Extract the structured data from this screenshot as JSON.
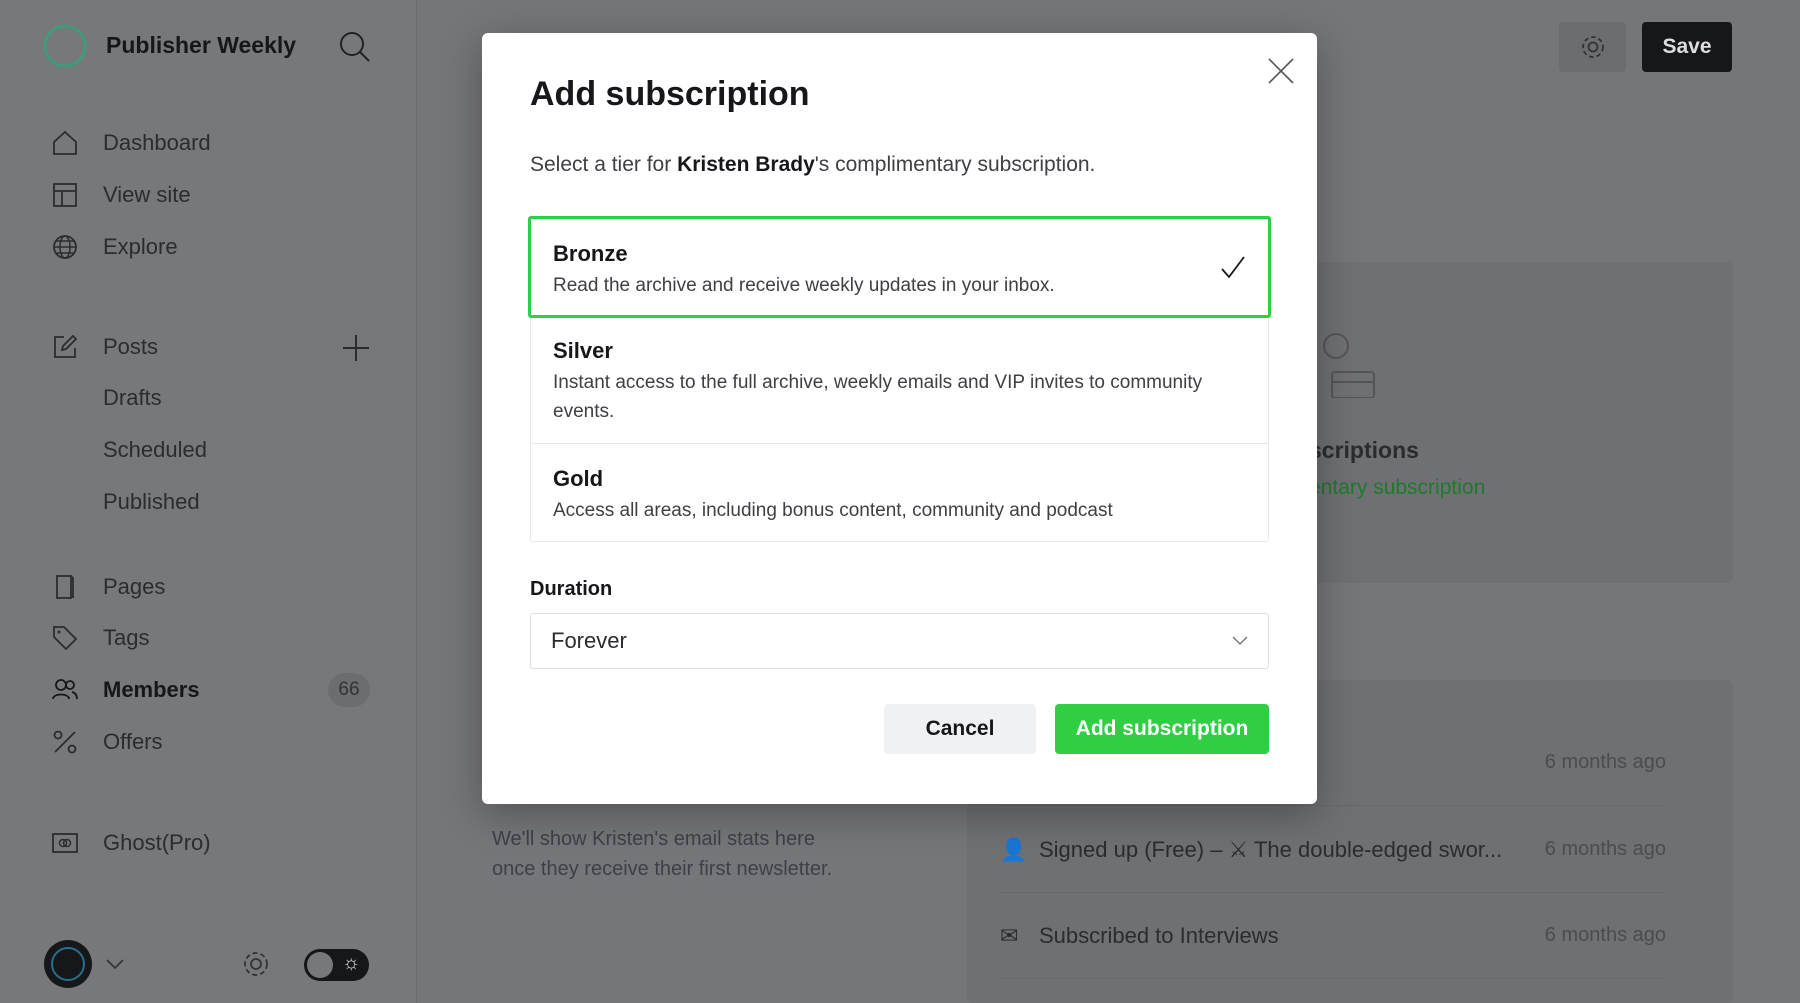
{
  "sidebar": {
    "site_title": "Publisher Weekly",
    "items": [
      {
        "label": "Dashboard",
        "icon": "home-icon"
      },
      {
        "label": "View site",
        "icon": "layout-icon"
      },
      {
        "label": "Explore",
        "icon": "globe-icon"
      },
      {
        "label": "Posts",
        "icon": "edit-icon"
      },
      {
        "label": "Drafts"
      },
      {
        "label": "Scheduled"
      },
      {
        "label": "Published"
      },
      {
        "label": "Pages",
        "icon": "page-icon"
      },
      {
        "label": "Tags",
        "icon": "tag-icon"
      },
      {
        "label": "Members",
        "icon": "members-icon",
        "count": "66"
      },
      {
        "label": "Offers",
        "icon": "percent-icon"
      },
      {
        "label": "Ghost(Pro)",
        "icon": "ghost-pro-icon"
      }
    ]
  },
  "header": {
    "save_label": "Save"
  },
  "background": {
    "subscriptions_title": "scriptions",
    "complimentary_link": "entary subscription",
    "email_stats": "We'll show Kristen's email stats here once they receive their first newsletter.",
    "activity": [
      {
        "text": "",
        "time": "6 months ago"
      },
      {
        "text": "Signed up (Free) – ⚔ The double-edged swor...",
        "time": "6 months ago"
      },
      {
        "text": "Subscribed to Interviews",
        "time": "6 months ago"
      }
    ]
  },
  "modal": {
    "title": "Add subscription",
    "subtitle_pre": "Select a tier for ",
    "member_name": "Kristen Brady",
    "subtitle_post": "'s complimentary subscription.",
    "tiers": [
      {
        "name": "Bronze",
        "description": "Read the archive and receive weekly updates in your inbox.",
        "selected": true
      },
      {
        "name": "Silver",
        "description": "Instant access to the full archive, weekly emails and VIP invites to community events.",
        "selected": false
      },
      {
        "name": "Gold",
        "description": "Access all areas, including bonus content, community and podcast",
        "selected": false
      }
    ],
    "duration_label": "Duration",
    "duration_value": "Forever",
    "cancel_label": "Cancel",
    "submit_label": "Add subscription"
  },
  "colors": {
    "accent": "#30cf43",
    "overlay_bg": "#757679"
  }
}
